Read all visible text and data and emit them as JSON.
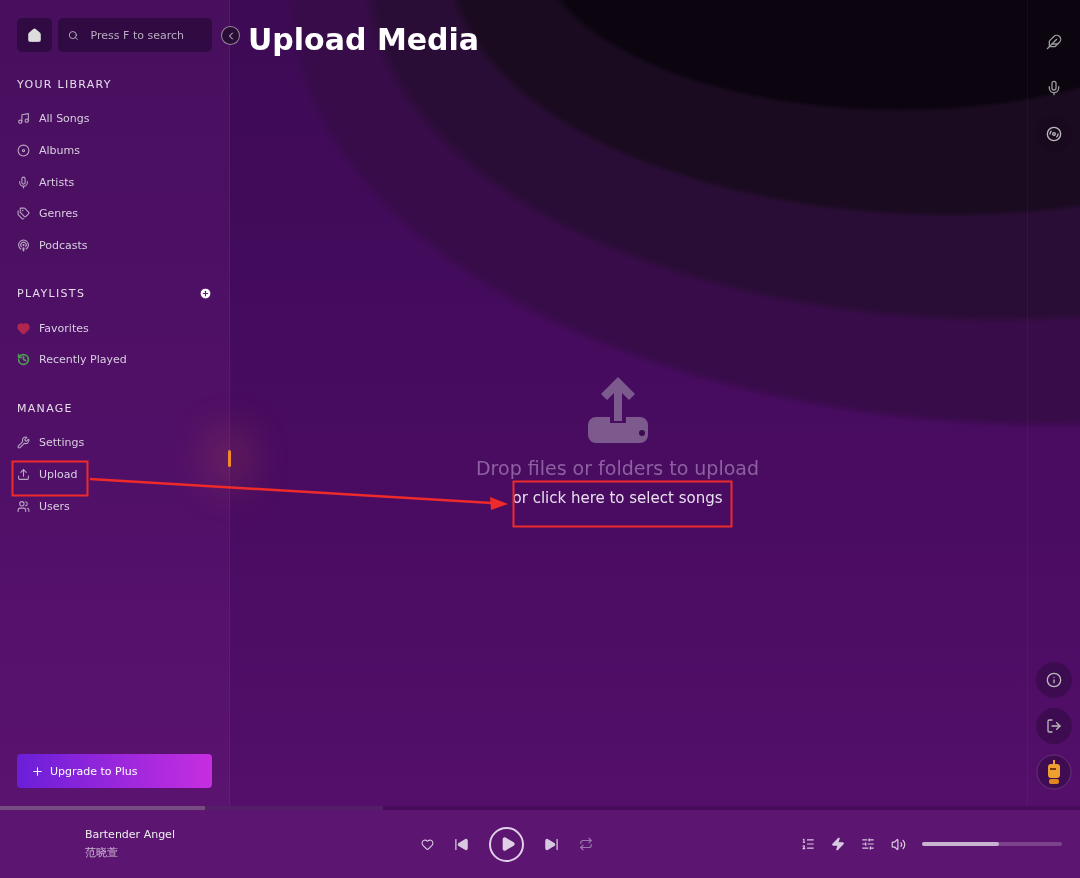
{
  "search": {
    "placeholder": "Press F to search"
  },
  "sidebar": {
    "sections": [
      {
        "title": "YOUR LIBRARY",
        "kind": "library",
        "items": [
          {
            "label": "All Songs"
          },
          {
            "label": "Albums"
          },
          {
            "label": "Artists"
          },
          {
            "label": "Genres"
          },
          {
            "label": "Podcasts"
          }
        ]
      },
      {
        "title": "PLAYLISTS",
        "kind": "playlists",
        "items": [
          {
            "label": "Favorites",
            "color": "#b0264f"
          },
          {
            "label": "Recently Played",
            "color": "#4e9a52"
          }
        ]
      },
      {
        "title": "MANAGE",
        "kind": "manage",
        "items": [
          {
            "label": "Settings"
          },
          {
            "label": "Upload"
          },
          {
            "label": "Users"
          }
        ]
      }
    ],
    "upgrade_button": "Upgrade to Plus"
  },
  "page": {
    "title": "Upload Media"
  },
  "drop_zone": {
    "message": "Drop files or folders to upload",
    "link": "or click here to select songs"
  },
  "player": {
    "song": "Bartender Angel",
    "artist": "范晓萱",
    "progress": {
      "level": 0.19
    },
    "buffer": {
      "level": 0.355
    },
    "volume": {
      "level": 0.55
    }
  }
}
